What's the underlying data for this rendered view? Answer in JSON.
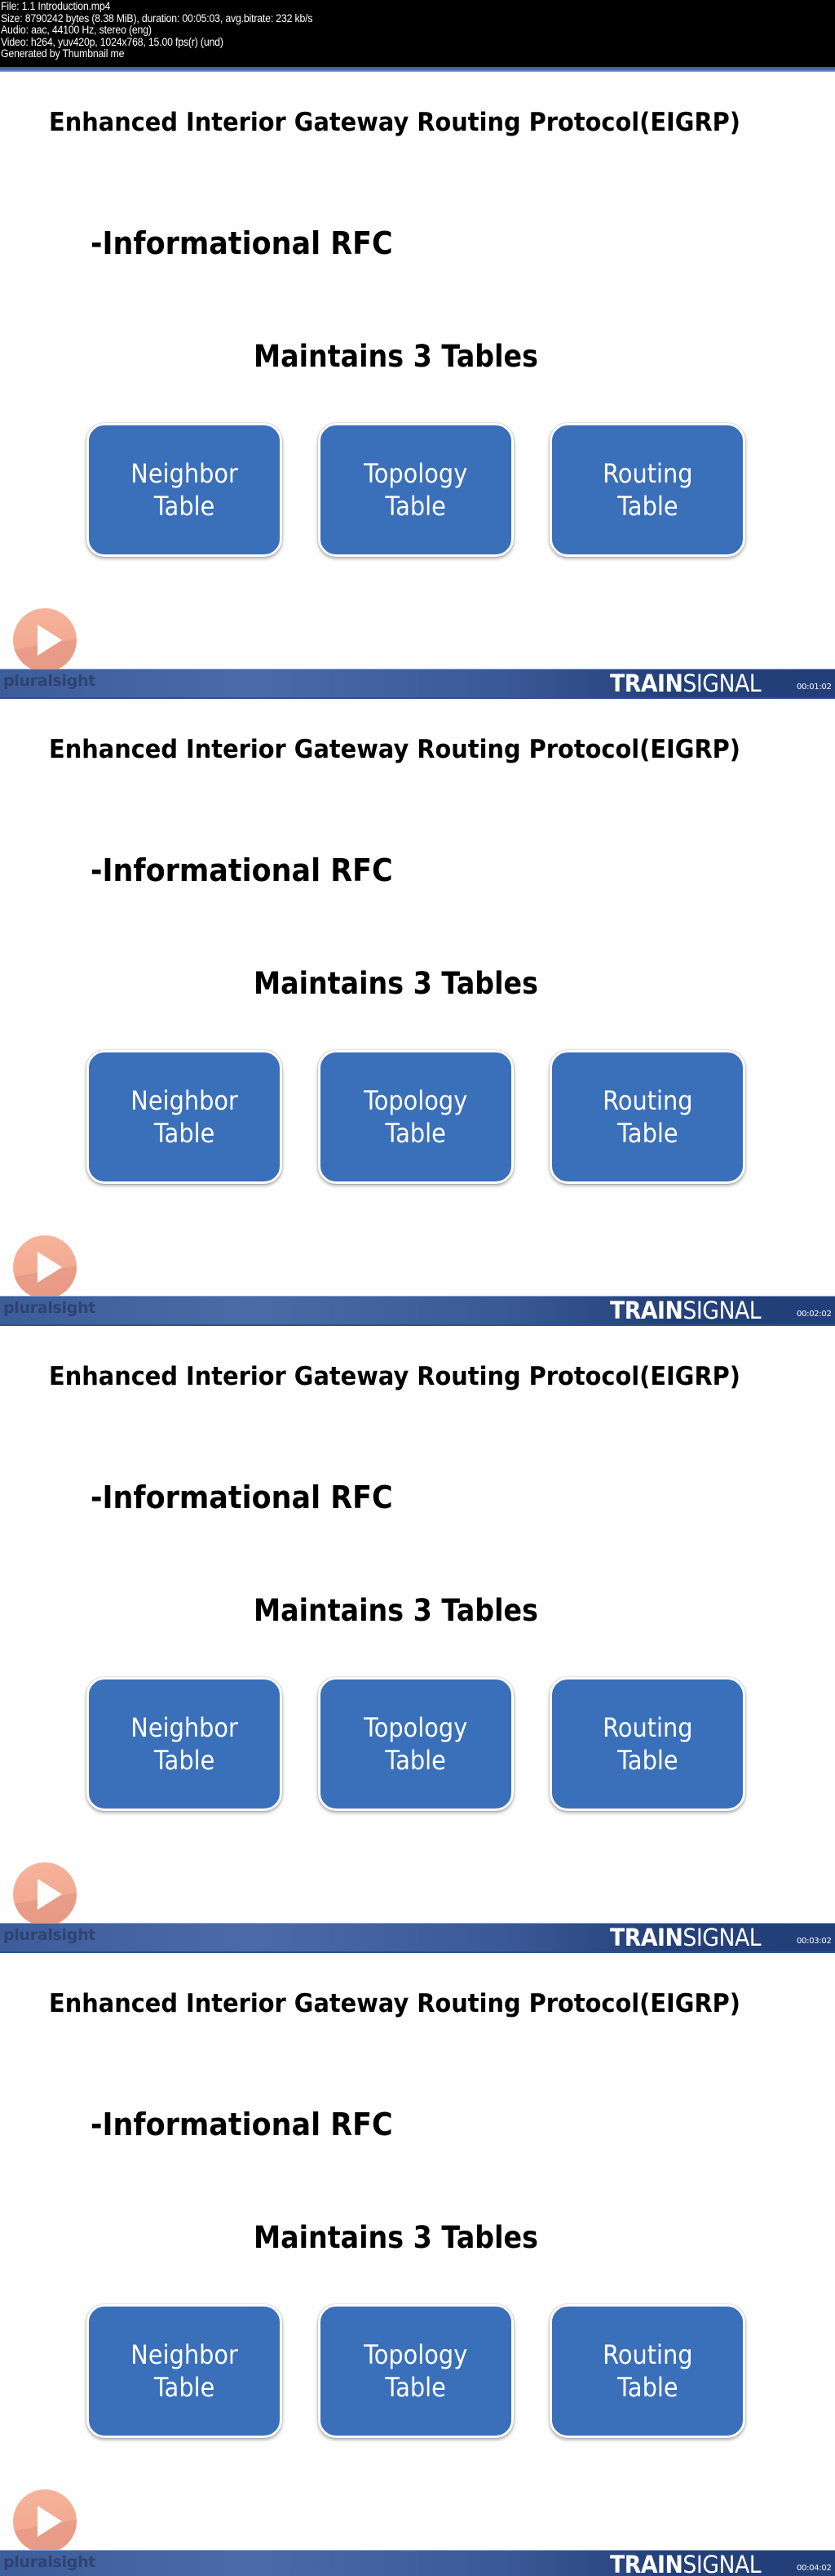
{
  "file_info": {
    "lines": [
      "File: 1.1 Introduction.mp4",
      "Size: 8790242 bytes (8.38 MiB), duration: 00:05:03, avg.bitrate: 232 kb/s",
      "Audio: aac, 44100 Hz, stereo (eng)",
      "Video: h264, yuv420p, 1024x768, 15.00 fps(r) (und)",
      "Generated by Thumbnail me"
    ]
  },
  "slide": {
    "title": "Enhanced Interior Gateway Routing Protocol(EIGRP)",
    "bullet": "-Informational RFC",
    "subheading": "Maintains 3 Tables",
    "tables": [
      {
        "line1": "Neighbor",
        "line2": "Table"
      },
      {
        "line1": "Topology",
        "line2": "Table"
      },
      {
        "line1": "Routing",
        "line2": "Table"
      }
    ],
    "box_color": "#3a6fb9"
  },
  "branding": {
    "left_logo": "pluralsight",
    "right_logo_bold": "TRAIN",
    "right_logo_regular": "SIGNAL",
    "play_icon_color": "#f3a68c"
  },
  "frames": [
    {
      "timestamp": "00:01:02"
    },
    {
      "timestamp": "00:02:02"
    },
    {
      "timestamp": "00:03:02"
    },
    {
      "timestamp": "00:04:02"
    }
  ]
}
